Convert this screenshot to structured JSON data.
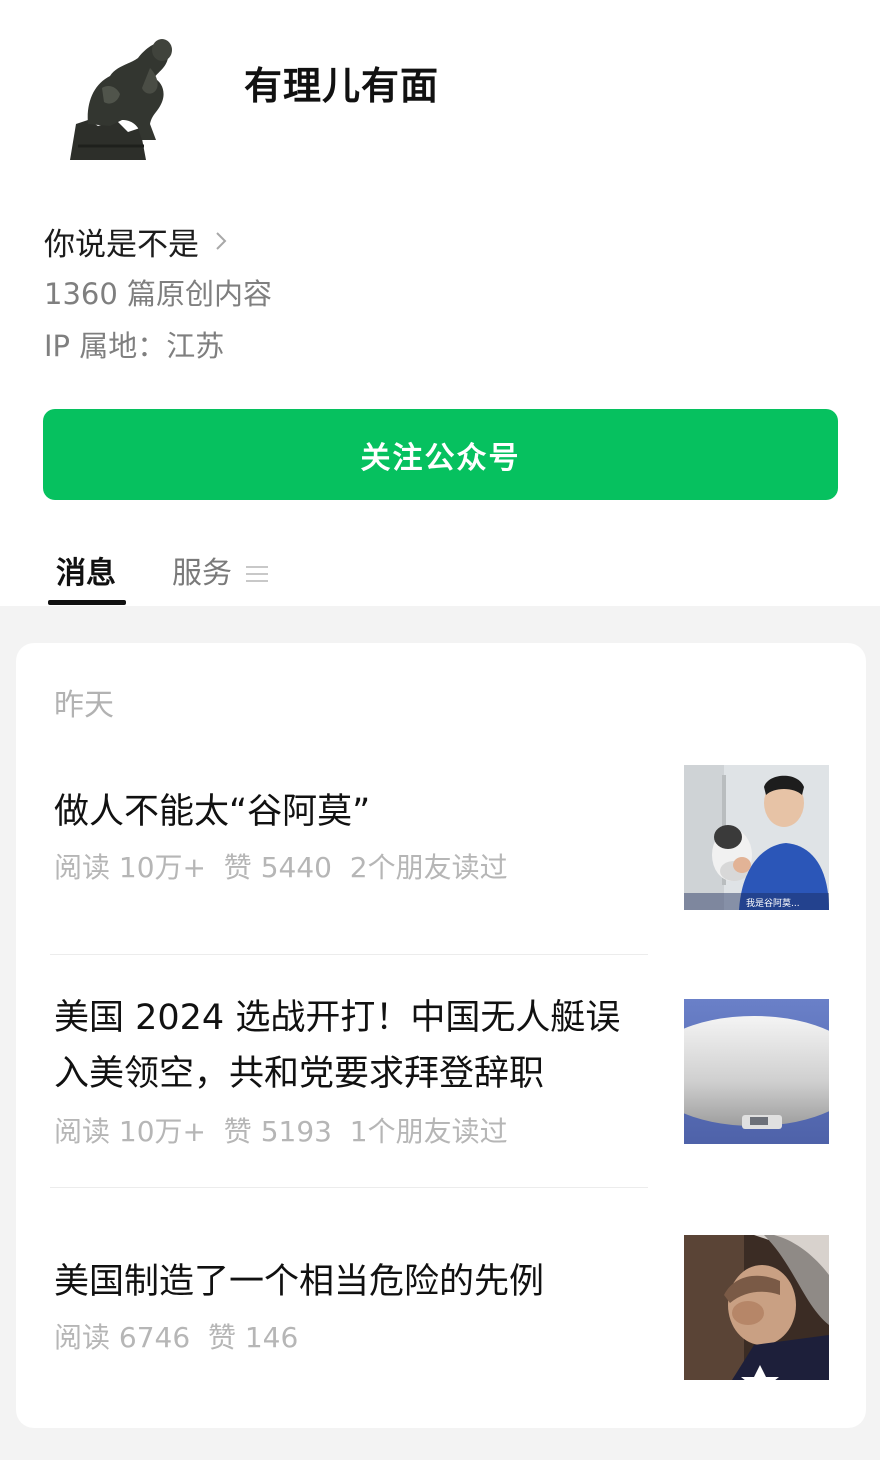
{
  "account": {
    "name": "有理儿有面",
    "bio": "你说是不是",
    "articles_count": "1360 篇原创内容",
    "ip_location": "IP 属地：江苏"
  },
  "follow_button_label": "关注公众号",
  "tabs": [
    {
      "label": "消息",
      "active": true
    },
    {
      "label": "服务",
      "active": false
    }
  ],
  "feed": {
    "date_label": "昨天",
    "articles": [
      {
        "title": "做人不能太“谷阿莫”",
        "stats": "阅读 10万+  赞 5440  2个朋友读过",
        "thumb_caption": "我是谷阿莫..."
      },
      {
        "title": "美国 2024 选战开打！中国无人艇误入美领空，共和党要求拜登辞职",
        "stats": "阅读 10万+  赞 5193  1个朋友读过"
      },
      {
        "title": "美国制造了一个相当危险的先例",
        "stats": "阅读 6746  赞 146"
      }
    ]
  },
  "colors": {
    "accent_green": "#06c15f",
    "feed_background": "#f3f3f3",
    "muted_text": "#b6b6b6"
  },
  "icons": [
    "chevron-right-icon",
    "menu-icon"
  ]
}
